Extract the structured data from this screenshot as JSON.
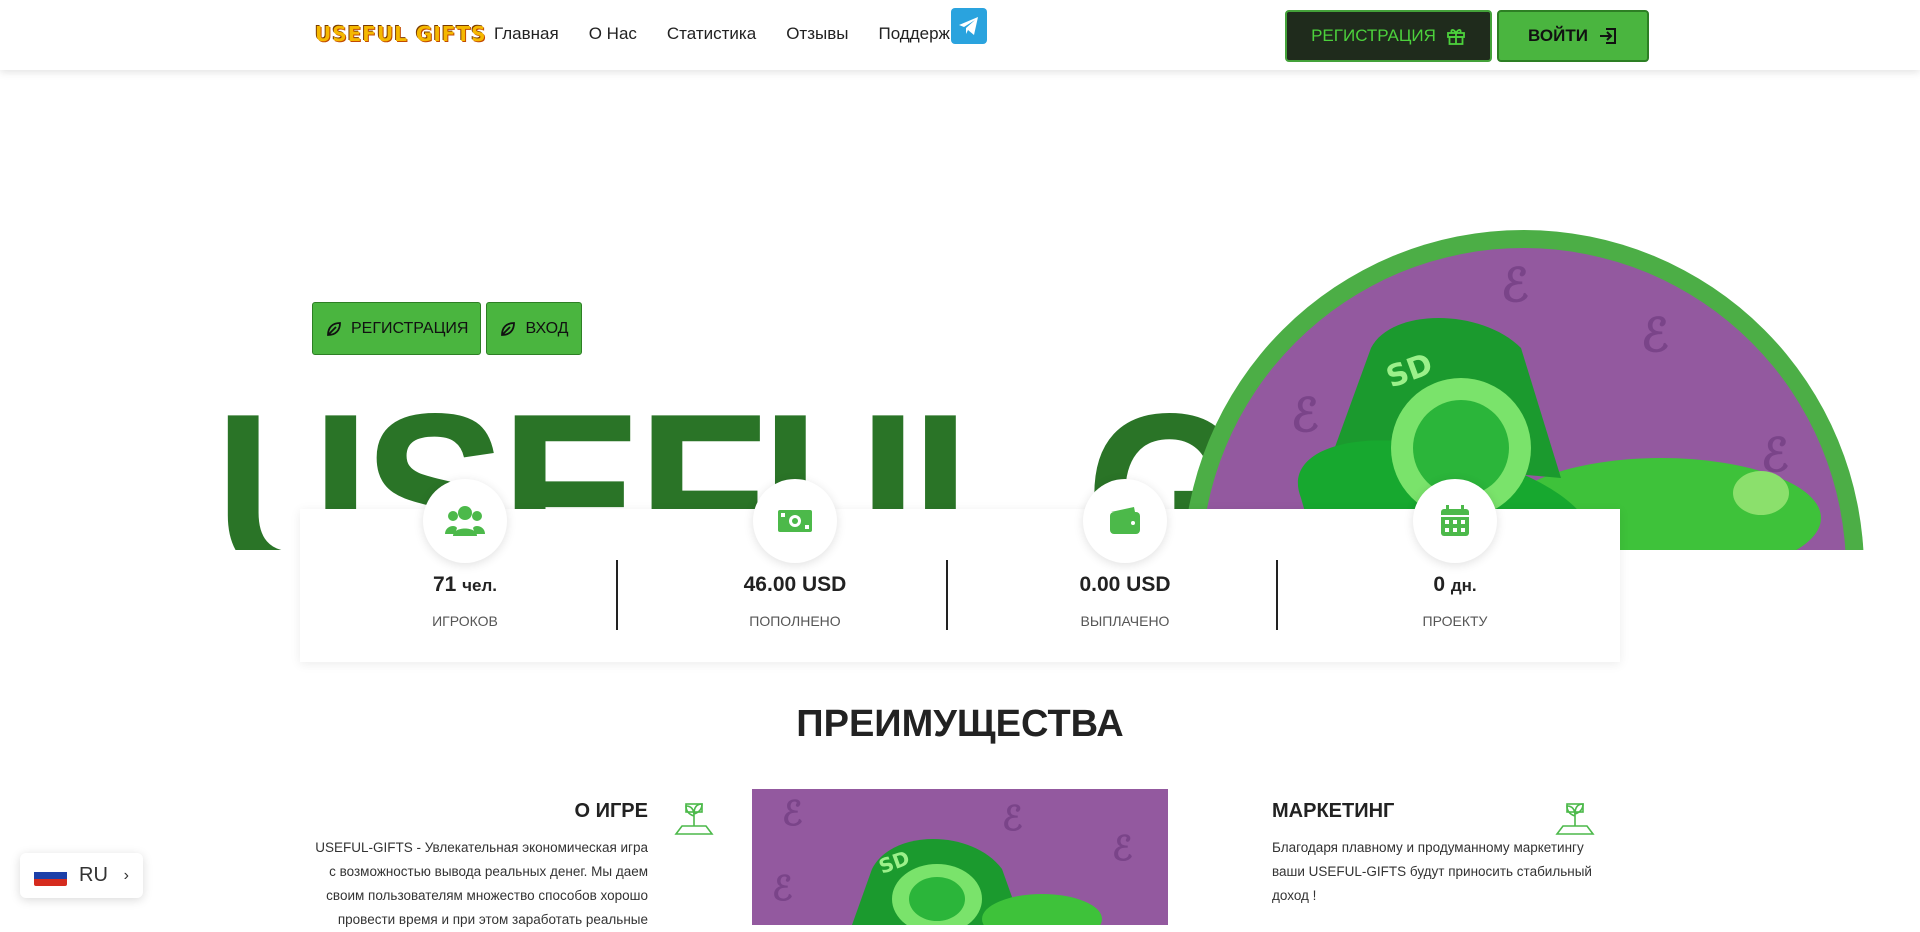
{
  "header": {
    "logo": "USEFUL GIFTS",
    "nav": [
      "Главная",
      "О Нас",
      "Статистика",
      "Отзывы",
      "Поддержка"
    ],
    "register_label": "РЕГИСТРАЦИЯ",
    "login_label": "ВОЙТИ"
  },
  "hero": {
    "register_label": "РЕГИСТРАЦИЯ",
    "login_label": "ВХОД",
    "title": "USEFUL GIFTS"
  },
  "stats": [
    {
      "value": "71",
      "unit": "чел.",
      "label": "ИГРОКОВ",
      "icon": "users-icon"
    },
    {
      "value": "46.00 USD",
      "unit": "",
      "label": "ПОПОЛНЕНО",
      "icon": "money-icon"
    },
    {
      "value": "0.00 USD",
      "unit": "",
      "label": "ВЫПЛАЧЕНО",
      "icon": "wallet-icon"
    },
    {
      "value": "0",
      "unit": "дн.",
      "label": "ПРОЕКТУ",
      "icon": "calendar-icon"
    }
  ],
  "advantages": {
    "title": "ПРЕИМУЩЕСТВА",
    "about": {
      "title": "О ИГРЕ",
      "text": "USEFUL-GIFTS - Увлекательная экономическая игра с возможностью вывода реальных денег. Мы даем своим пользователям множество способов хорошо провести время и при этом заработать реальные"
    },
    "marketing": {
      "title": "МАРКЕТИНГ",
      "text": "Благодаря плавному и продуманному маркетингу ваши USEFUL-GIFTS будут приносить стабильный доход !"
    }
  },
  "language": {
    "code": "RU"
  },
  "colors": {
    "accent": "#4ab53f",
    "dark_green": "#2a7427",
    "purple": "#93599f"
  }
}
